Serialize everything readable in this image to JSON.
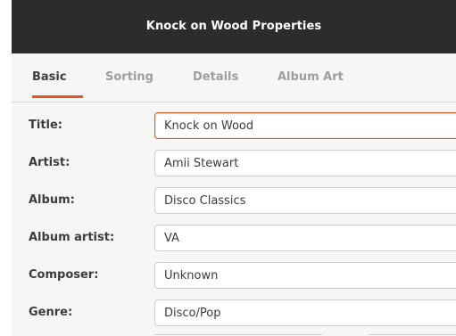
{
  "window": {
    "title": "Knock on Wood Properties"
  },
  "tabs": [
    {
      "label": "Basic",
      "active": true
    },
    {
      "label": "Sorting",
      "active": false
    },
    {
      "label": "Details",
      "active": false
    },
    {
      "label": "Album Art",
      "active": false
    }
  ],
  "fields": [
    {
      "label": "Title:",
      "value": "Knock on Wood"
    },
    {
      "label": "Artist:",
      "value": "Amii Stewart"
    },
    {
      "label": "Album:",
      "value": "Disco Classics"
    },
    {
      "label": "Album artist:",
      "value": "VA"
    },
    {
      "label": "Composer:",
      "value": "Unknown"
    },
    {
      "label": "Genre:",
      "value": "Disco/Pop"
    }
  ],
  "colors": {
    "accent": "#e95420",
    "titlebar": "#2c2c2c"
  }
}
